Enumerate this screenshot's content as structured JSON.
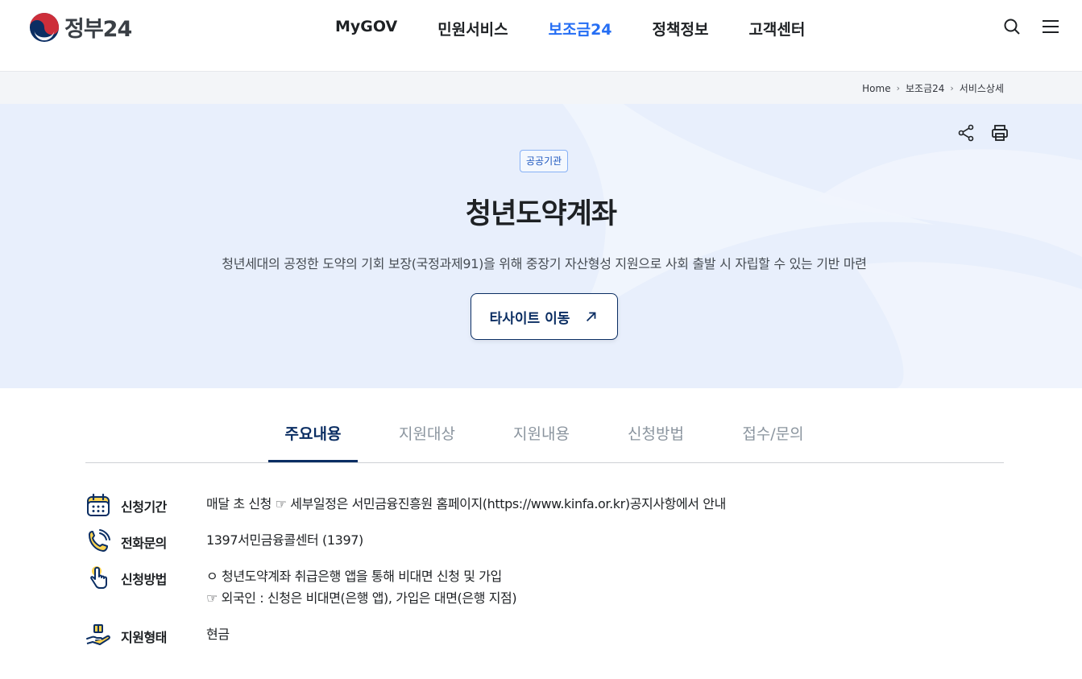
{
  "header": {
    "logo_text": "정부24",
    "nav": [
      {
        "label": "MyGOV",
        "active": false
      },
      {
        "label": "민원서비스",
        "active": false
      },
      {
        "label": "보조금24",
        "active": true
      },
      {
        "label": "정책정보",
        "active": false
      },
      {
        "label": "고객센터",
        "active": false
      }
    ],
    "icons": {
      "search": "search-icon",
      "menu": "hamburger-menu-icon"
    }
  },
  "breadcrumb": {
    "items": [
      "Home",
      "보조금24",
      "서비스상세"
    ]
  },
  "hero": {
    "badge": "공공기관",
    "title": "청년도약계좌",
    "description": "청년세대의 공정한 도약의 기회 보장(국정과제91)을 위해 중장기 자산형성 지원으로 사회 출발 시 자립할 수 있는 기반 마련",
    "button_label": "타사이트 이동",
    "icons": {
      "share": "share-icon",
      "print": "print-icon",
      "button": "arrow-up-right-icon"
    }
  },
  "tabs": [
    {
      "label": "주요내용",
      "active": true
    },
    {
      "label": "지원대상",
      "active": false
    },
    {
      "label": "지원내용",
      "active": false
    },
    {
      "label": "신청방법",
      "active": false
    },
    {
      "label": "접수/문의",
      "active": false
    }
  ],
  "info": {
    "period": {
      "label": "신청기간",
      "value": "매달 초 신청 ☞ 세부일정은 서민금융진흥원 홈페이지(https://www.kinfa.or.kr)공지사항에서 안내",
      "icon": "calendar-icon"
    },
    "phone": {
      "label": "전화문의",
      "value": "1397서민금융콜센터 (1397)",
      "icon": "phone-icon"
    },
    "method": {
      "label": "신청방법",
      "lines": [
        "ㅇ 청년도약계좌 취급은행 앱을 통해 비대면 신청 및 가입",
        "☞ 외국인 : 신청은 비대면(은행 앱), 가입은 대면(은행 지점)"
      ],
      "icon": "hand-pointer-icon"
    },
    "type": {
      "label": "지원형태",
      "value": "현금",
      "icon": "hand-gift-icon"
    }
  },
  "colors": {
    "brand": "#0b2e63",
    "accent": "#256ef4",
    "hero_bg": "#e8effc",
    "icon_yellow": "#ffd44f"
  }
}
